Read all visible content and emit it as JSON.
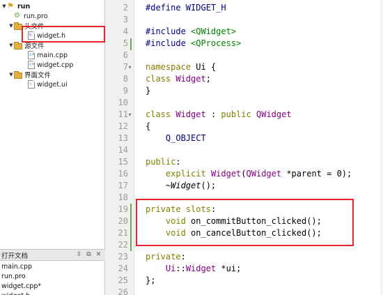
{
  "project_tree": {
    "items": [
      {
        "label": "run",
        "kind": "run",
        "expanded": true
      },
      {
        "label": "run.pro",
        "kind": "pro"
      },
      {
        "label": "头文件",
        "kind": "folder",
        "expanded": true
      },
      {
        "label": "widget.h",
        "kind": "h"
      },
      {
        "label": "源文件",
        "kind": "folder",
        "expanded": true
      },
      {
        "label": "main.cpp",
        "kind": "cpp"
      },
      {
        "label": "widget.cpp",
        "kind": "cpp"
      },
      {
        "label": "界面文件",
        "kind": "folder",
        "expanded": true
      },
      {
        "label": "widget.ui",
        "kind": "ui"
      }
    ]
  },
  "open_documents": {
    "title": "打开文档",
    "items": [
      "main.cpp",
      "run.pro",
      "widget.cpp*",
      "widget.h"
    ]
  },
  "editor": {
    "line_numbers": [
      "2",
      "3",
      "4",
      "5",
      "6",
      "7",
      "8",
      "9",
      "10",
      "11",
      "12",
      "13",
      "14",
      "15",
      "16",
      "17",
      "18",
      "19",
      "20",
      "21",
      "22",
      "23",
      "24",
      "25",
      "26"
    ],
    "lines": [
      {
        "tokens": [
          {
            "t": "#define WIDGET_H",
            "c": "pp"
          }
        ]
      },
      {
        "tokens": []
      },
      {
        "tokens": [
          {
            "t": "#include ",
            "c": "pp"
          },
          {
            "t": "<QWidget>",
            "c": "inc"
          }
        ]
      },
      {
        "tokens": [
          {
            "t": "#include ",
            "c": "pp"
          },
          {
            "t": "<QProcess>",
            "c": "inc"
          }
        ]
      },
      {
        "tokens": []
      },
      {
        "tokens": [
          {
            "t": "namespace",
            "c": "kw"
          },
          {
            "t": " Ui {",
            "c": ""
          }
        ]
      },
      {
        "tokens": [
          {
            "t": "class",
            "c": "kw"
          },
          {
            "t": " ",
            "c": ""
          },
          {
            "t": "Widget",
            "c": "cls"
          },
          {
            "t": ";",
            "c": ""
          }
        ]
      },
      {
        "tokens": [
          {
            "t": "}",
            "c": ""
          }
        ]
      },
      {
        "tokens": []
      },
      {
        "tokens": [
          {
            "t": "class",
            "c": "kw"
          },
          {
            "t": " ",
            "c": ""
          },
          {
            "t": "Widget",
            "c": "cls"
          },
          {
            "t": " : ",
            "c": ""
          },
          {
            "t": "public",
            "c": "kw"
          },
          {
            "t": " ",
            "c": ""
          },
          {
            "t": "QWidget",
            "c": "cls"
          }
        ]
      },
      {
        "tokens": [
          {
            "t": "{",
            "c": ""
          }
        ]
      },
      {
        "tokens": [
          {
            "t": "    Q_OBJECT",
            "c": "pp"
          }
        ]
      },
      {
        "tokens": []
      },
      {
        "tokens": [
          {
            "t": "public",
            "c": "kw"
          },
          {
            "t": ":",
            "c": ""
          }
        ]
      },
      {
        "tokens": [
          {
            "t": "    ",
            "c": ""
          },
          {
            "t": "explicit",
            "c": "kw"
          },
          {
            "t": " ",
            "c": ""
          },
          {
            "t": "Widget",
            "c": "cls"
          },
          {
            "t": "(",
            "c": ""
          },
          {
            "t": "QWidget",
            "c": "cls"
          },
          {
            "t": " *parent = 0);",
            "c": ""
          }
        ]
      },
      {
        "tokens": [
          {
            "t": "    ~",
            "c": ""
          },
          {
            "t": "Widget",
            "c": "ital"
          },
          {
            "t": "();",
            "c": ""
          }
        ]
      },
      {
        "tokens": []
      },
      {
        "tokens": [
          {
            "t": "private",
            "c": "kw"
          },
          {
            "t": " ",
            "c": ""
          },
          {
            "t": "slots",
            "c": "kw"
          },
          {
            "t": ":",
            "c": ""
          }
        ]
      },
      {
        "tokens": [
          {
            "t": "    ",
            "c": ""
          },
          {
            "t": "void",
            "c": "kw"
          },
          {
            "t": " on_commitButton_clicked();",
            "c": ""
          }
        ]
      },
      {
        "tokens": [
          {
            "t": "    ",
            "c": ""
          },
          {
            "t": "void",
            "c": "kw"
          },
          {
            "t": " on_cancelButton_clicked();",
            "c": ""
          }
        ]
      },
      {
        "tokens": []
      },
      {
        "tokens": [
          {
            "t": "private",
            "c": "kw"
          },
          {
            "t": ":",
            "c": ""
          }
        ]
      },
      {
        "tokens": [
          {
            "t": "    ",
            "c": ""
          },
          {
            "t": "Ui",
            "c": "cls"
          },
          {
            "t": "::",
            "c": ""
          },
          {
            "t": "Widget",
            "c": "cls"
          },
          {
            "t": " *ui;",
            "c": ""
          }
        ]
      },
      {
        "tokens": [
          {
            "t": "};",
            "c": ""
          }
        ]
      },
      {
        "tokens": []
      }
    ]
  },
  "colors": {
    "highlight_box": "#e8232a",
    "keyword": "#808000",
    "preprocessor": "#000080",
    "include": "#008000",
    "class": "#800080",
    "change_bar": "#6aa84f"
  }
}
